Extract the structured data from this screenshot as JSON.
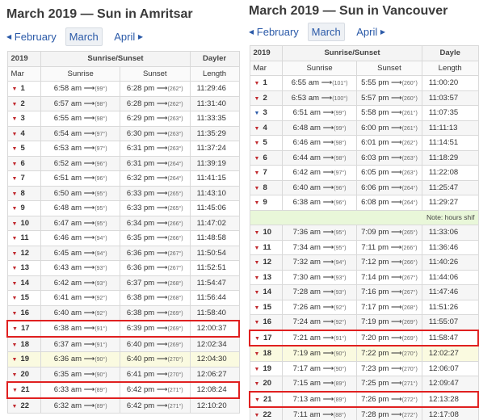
{
  "left": {
    "title": "March 2019 — Sun in Amritsar",
    "nav": {
      "prev": "February",
      "current": "March",
      "next": "April"
    },
    "headers": {
      "year": "2019",
      "sunrise_sunset": "Sunrise/Sunset",
      "daylength": "Dayler",
      "month": "Mar",
      "sunrise": "Sunrise",
      "sunset": "Sunset",
      "length": "Length"
    },
    "rows": [
      {
        "day": "1",
        "sunrise": "6:58 am",
        "sr_deg": "(99°)",
        "sunset": "6:28 pm",
        "ss_deg": "(262°)",
        "length": "11:29:46"
      },
      {
        "day": "2",
        "sunrise": "6:57 am",
        "sr_deg": "(98°)",
        "sunset": "6:28 pm",
        "ss_deg": "(262°)",
        "length": "11:31:40"
      },
      {
        "day": "3",
        "sunrise": "6:55 am",
        "sr_deg": "(98°)",
        "sunset": "6:29 pm",
        "ss_deg": "(263°)",
        "length": "11:33:35"
      },
      {
        "day": "4",
        "sunrise": "6:54 am",
        "sr_deg": "(97°)",
        "sunset": "6:30 pm",
        "ss_deg": "(263°)",
        "length": "11:35:29"
      },
      {
        "day": "5",
        "sunrise": "6:53 am",
        "sr_deg": "(97°)",
        "sunset": "6:31 pm",
        "ss_deg": "(263°)",
        "length": "11:37:24"
      },
      {
        "day": "6",
        "sunrise": "6:52 am",
        "sr_deg": "(96°)",
        "sunset": "6:31 pm",
        "ss_deg": "(264°)",
        "length": "11:39:19"
      },
      {
        "day": "7",
        "sunrise": "6:51 am",
        "sr_deg": "(96°)",
        "sunset": "6:32 pm",
        "ss_deg": "(264°)",
        "length": "11:41:15"
      },
      {
        "day": "8",
        "sunrise": "6:50 am",
        "sr_deg": "(95°)",
        "sunset": "6:33 pm",
        "ss_deg": "(265°)",
        "length": "11:43:10"
      },
      {
        "day": "9",
        "sunrise": "6:48 am",
        "sr_deg": "(95°)",
        "sunset": "6:33 pm",
        "ss_deg": "(265°)",
        "length": "11:45:06"
      },
      {
        "day": "10",
        "sunrise": "6:47 am",
        "sr_deg": "(95°)",
        "sunset": "6:34 pm",
        "ss_deg": "(266°)",
        "length": "11:47:02"
      },
      {
        "day": "11",
        "sunrise": "6:46 am",
        "sr_deg": "(94°)",
        "sunset": "6:35 pm",
        "ss_deg": "(266°)",
        "length": "11:48:58"
      },
      {
        "day": "12",
        "sunrise": "6:45 am",
        "sr_deg": "(94°)",
        "sunset": "6:36 pm",
        "ss_deg": "(267°)",
        "length": "11:50:54"
      },
      {
        "day": "13",
        "sunrise": "6:43 am",
        "sr_deg": "(93°)",
        "sunset": "6:36 pm",
        "ss_deg": "(267°)",
        "length": "11:52:51"
      },
      {
        "day": "14",
        "sunrise": "6:42 am",
        "sr_deg": "(93°)",
        "sunset": "6:37 pm",
        "ss_deg": "(268°)",
        "length": "11:54:47"
      },
      {
        "day": "15",
        "sunrise": "6:41 am",
        "sr_deg": "(92°)",
        "sunset": "6:38 pm",
        "ss_deg": "(268°)",
        "length": "11:56:44"
      },
      {
        "day": "16",
        "sunrise": "6:40 am",
        "sr_deg": "(92°)",
        "sunset": "6:38 pm",
        "ss_deg": "(269°)",
        "length": "11:58:40"
      },
      {
        "day": "17",
        "sunrise": "6:38 am",
        "sr_deg": "(91°)",
        "sunset": "6:39 pm",
        "ss_deg": "(269°)",
        "length": "12:00:37",
        "highlight": true
      },
      {
        "day": "18",
        "sunrise": "6:37 am",
        "sr_deg": "(91°)",
        "sunset": "6:40 pm",
        "ss_deg": "(269°)",
        "length": "12:02:34"
      },
      {
        "day": "19",
        "sunrise": "6:36 am",
        "sr_deg": "(90°)",
        "sunset": "6:40 pm",
        "ss_deg": "(270°)",
        "length": "12:04:30",
        "equinox": true
      },
      {
        "day": "20",
        "sunrise": "6:35 am",
        "sr_deg": "(90°)",
        "sunset": "6:41 pm",
        "ss_deg": "(270°)",
        "length": "12:06:27"
      },
      {
        "day": "21",
        "sunrise": "6:33 am",
        "sr_deg": "(89°)",
        "sunset": "6:42 pm",
        "ss_deg": "(271°)",
        "length": "12:08:24",
        "highlight": true
      },
      {
        "day": "22",
        "sunrise": "6:32 am",
        "sr_deg": "(89°)",
        "sunset": "6:42 pm",
        "ss_deg": "(271°)",
        "length": "12:10:20"
      }
    ]
  },
  "right": {
    "title": "March 2019 — Sun in Vancouver",
    "nav": {
      "prev": "February",
      "current": "March",
      "next": "April"
    },
    "headers": {
      "year": "2019",
      "sunrise_sunset": "Sunrise/Sunset",
      "daylength": "Dayle",
      "month": "Mar",
      "sunrise": "Sunrise",
      "sunset": "Sunset",
      "length": "Length"
    },
    "note": "Note: hours shif",
    "rows": [
      {
        "day": "1",
        "sunrise": "6:55 am",
        "sr_deg": "(101°)",
        "sunset": "5:55 pm",
        "ss_deg": "(260°)",
        "length": "11:00:20"
      },
      {
        "day": "2",
        "sunrise": "6:53 am",
        "sr_deg": "(100°)",
        "sunset": "5:57 pm",
        "ss_deg": "(260°)",
        "length": "11:03:57"
      },
      {
        "day": "3",
        "sunrise": "6:51 am",
        "sr_deg": "(99°)",
        "sunset": "5:58 pm",
        "ss_deg": "(261°)",
        "length": "11:07:35",
        "blue": true
      },
      {
        "day": "4",
        "sunrise": "6:48 am",
        "sr_deg": "(99°)",
        "sunset": "6:00 pm",
        "ss_deg": "(261°)",
        "length": "11:11:13"
      },
      {
        "day": "5",
        "sunrise": "6:46 am",
        "sr_deg": "(98°)",
        "sunset": "6:01 pm",
        "ss_deg": "(262°)",
        "length": "11:14:51"
      },
      {
        "day": "6",
        "sunrise": "6:44 am",
        "sr_deg": "(98°)",
        "sunset": "6:03 pm",
        "ss_deg": "(263°)",
        "length": "11:18:29"
      },
      {
        "day": "7",
        "sunrise": "6:42 am",
        "sr_deg": "(97°)",
        "sunset": "6:05 pm",
        "ss_deg": "(263°)",
        "length": "11:22:08"
      },
      {
        "day": "8",
        "sunrise": "6:40 am",
        "sr_deg": "(96°)",
        "sunset": "6:06 pm",
        "ss_deg": "(264°)",
        "length": "11:25:47"
      },
      {
        "day": "9",
        "sunrise": "6:38 am",
        "sr_deg": "(96°)",
        "sunset": "6:08 pm",
        "ss_deg": "(264°)",
        "length": "11:29:27"
      },
      {
        "day": "10",
        "sunrise": "7:36 am",
        "sr_deg": "(95°)",
        "sunset": "7:09 pm",
        "ss_deg": "(265°)",
        "length": "11:33:06"
      },
      {
        "day": "11",
        "sunrise": "7:34 am",
        "sr_deg": "(95°)",
        "sunset": "7:11 pm",
        "ss_deg": "(266°)",
        "length": "11:36:46"
      },
      {
        "day": "12",
        "sunrise": "7:32 am",
        "sr_deg": "(94°)",
        "sunset": "7:12 pm",
        "ss_deg": "(266°)",
        "length": "11:40:26"
      },
      {
        "day": "13",
        "sunrise": "7:30 am",
        "sr_deg": "(93°)",
        "sunset": "7:14 pm",
        "ss_deg": "(267°)",
        "length": "11:44:06"
      },
      {
        "day": "14",
        "sunrise": "7:28 am",
        "sr_deg": "(93°)",
        "sunset": "7:16 pm",
        "ss_deg": "(267°)",
        "length": "11:47:46"
      },
      {
        "day": "15",
        "sunrise": "7:26 am",
        "sr_deg": "(92°)",
        "sunset": "7:17 pm",
        "ss_deg": "(268°)",
        "length": "11:51:26"
      },
      {
        "day": "16",
        "sunrise": "7:24 am",
        "sr_deg": "(92°)",
        "sunset": "7:19 pm",
        "ss_deg": "(269°)",
        "length": "11:55:07"
      },
      {
        "day": "17",
        "sunrise": "7:21 am",
        "sr_deg": "(91°)",
        "sunset": "7:20 pm",
        "ss_deg": "(269°)",
        "length": "11:58:47",
        "highlight": true
      },
      {
        "day": "18",
        "sunrise": "7:19 am",
        "sr_deg": "(90°)",
        "sunset": "7:22 pm",
        "ss_deg": "(270°)",
        "length": "12:02:27",
        "equinox": true
      },
      {
        "day": "19",
        "sunrise": "7:17 am",
        "sr_deg": "(90°)",
        "sunset": "7:23 pm",
        "ss_deg": "(270°)",
        "length": "12:06:07"
      },
      {
        "day": "20",
        "sunrise": "7:15 am",
        "sr_deg": "(89°)",
        "sunset": "7:25 pm",
        "ss_deg": "(271°)",
        "length": "12:09:47"
      },
      {
        "day": "21",
        "sunrise": "7:13 am",
        "sr_deg": "(89°)",
        "sunset": "7:26 pm",
        "ss_deg": "(272°)",
        "length": "12:13:28",
        "highlight": true
      },
      {
        "day": "22",
        "sunrise": "7:11 am",
        "sr_deg": "(88°)",
        "sunset": "7:28 pm",
        "ss_deg": "(272°)",
        "length": "12:17:08"
      }
    ]
  },
  "colors": {
    "link": "#2b5aa8",
    "marker": "#c0282d",
    "highlight_border": "#e02020",
    "equinox_row": "#fafae0",
    "note_row": "#e9f7d9"
  },
  "icons": {
    "prev": "triangle-left-icon",
    "next": "triangle-right-icon",
    "row_marker": "triangle-down-icon"
  }
}
